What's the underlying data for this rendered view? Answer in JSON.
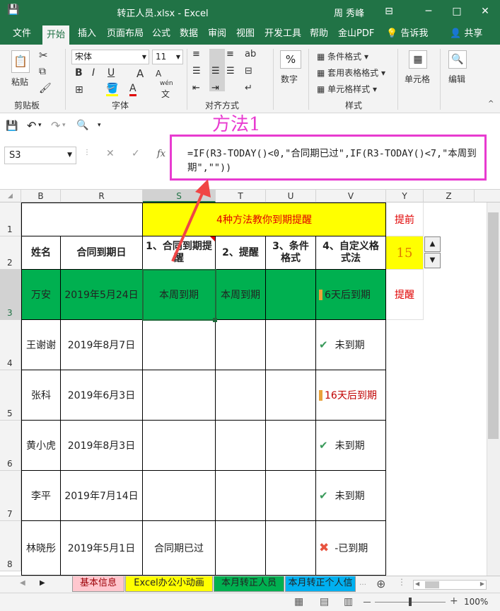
{
  "titlebar": {
    "title": "转正人员.xlsx  -  Excel",
    "user": "周 秀峰",
    "save_icon": "💾",
    "undo_icon": "↶",
    "redo_icon": "↷",
    "dropdown_icon": "▾",
    "min_icon": "─",
    "ribbon_opts_icon": "⊟",
    "max_icon": "□",
    "close_icon": "✕"
  },
  "tabs": [
    "文件",
    "开始",
    "插入",
    "页面布局",
    "公式",
    "数据",
    "审阅",
    "视图",
    "开发工具",
    "帮助",
    "金山PDF",
    "告诉我",
    "共享"
  ],
  "ribbon": {
    "paste_label": "粘贴",
    "clipboard_label": "剪贴板",
    "font_group_label": "字体",
    "font_name": "宋体",
    "font_size": "11",
    "bold": "B",
    "italic": "I",
    "underline": "U",
    "grow_font": "A",
    "shrink_font": "A",
    "font_color_letter": "A",
    "wen_label": "wén",
    "wen_char": "文",
    "align_group_label": "对齐方式",
    "number_label": "数字",
    "percent_icon": "%",
    "cond_format": "条件格式",
    "table_format": "套用表格格式",
    "cell_style": "单元格样式",
    "styles_label": "样式",
    "cells_label": "单元格",
    "edit_label": "编辑"
  },
  "annotation": {
    "method_label": "方法1"
  },
  "formula_bar": {
    "name_box": "S3",
    "fx": "fx",
    "cancel": "✕",
    "confirm": "✓",
    "formula": "=IF(R3-TODAY()<0,\"合同期已过\",IF(R3-TODAY()<7,\"本周到期\",\"\"))"
  },
  "columns": [
    "B",
    "R",
    "S",
    "T",
    "U",
    "V",
    "Y",
    "Z"
  ],
  "rows": [
    "1",
    "2",
    "3",
    "4",
    "5",
    "6",
    "7",
    "8"
  ],
  "sheet": {
    "title": "4种方法教你到期提醒",
    "tiqian": "提前",
    "tixing": "提醒",
    "days_value": "15",
    "headers": {
      "name": "姓名",
      "date": "合同到期日",
      "m1": "1、合同到期提醒",
      "m2": "2、提醒",
      "m3": "3、条件格式",
      "m4": "4、自定义格式法"
    },
    "data": [
      {
        "name": "万安",
        "date": "2019年5月24日",
        "s": "本周到期",
        "t": "本周到期",
        "v": "6天后到期",
        "icon": "excl"
      },
      {
        "name": "王谢谢",
        "date": "2019年8月7日",
        "s": "",
        "t": "",
        "v": "未到期",
        "icon": "check"
      },
      {
        "name": "张科",
        "date": "2019年6月3日",
        "s": "",
        "t": "",
        "v": "16天后到期",
        "icon": "excl"
      },
      {
        "name": "黄小虎",
        "date": "2019年8月3日",
        "s": "",
        "t": "",
        "v": "未到期",
        "icon": "check"
      },
      {
        "name": "李平",
        "date": "2019年7月14日",
        "s": "",
        "t": "",
        "v": "未到期",
        "icon": "check"
      },
      {
        "name": "林晓彤",
        "date": "2019年5月1日",
        "s": "合同期已过",
        "t": "",
        "v": "-已到期",
        "icon": "x"
      }
    ]
  },
  "sheet_tabs": [
    "基本信息",
    "Excel办公小动画",
    "本月转正人员",
    "本月转正个人信"
  ],
  "status": {
    "zoom": "100%",
    "zoom_minus": "－",
    "zoom_plus": "+",
    "add_sheet": "⊕"
  },
  "colors": {
    "excel_green": "#217346",
    "highlight_green": "#00b050",
    "yellow": "#ffff00",
    "magenta": "#e83bd0",
    "red_text": "#e00000",
    "orange_value": "#e07b00"
  }
}
